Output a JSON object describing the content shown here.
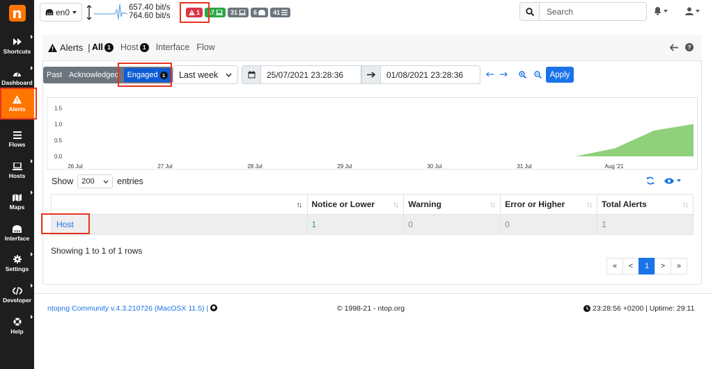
{
  "sidebar": {
    "logo": "n",
    "items": [
      {
        "label": "Shortcuts",
        "icon": "fast-forward-icon"
      },
      {
        "label": "Dashboard",
        "icon": "gauge-icon"
      },
      {
        "label": "Alerts",
        "icon": "warning-icon",
        "active": true
      },
      {
        "label": "Flows",
        "icon": "stream-icon"
      },
      {
        "label": "Hosts",
        "icon": "laptop-icon"
      },
      {
        "label": "Maps",
        "icon": "map-icon"
      },
      {
        "label": "Interface",
        "icon": "ethernet-icon"
      },
      {
        "label": "Settings",
        "icon": "gear-icon"
      },
      {
        "label": "Developer",
        "icon": "code-icon"
      },
      {
        "label": "Help",
        "icon": "life-ring-icon"
      }
    ]
  },
  "topbar": {
    "interface": "en0",
    "throughput_up": "657.40 bit/s",
    "throughput_down": "764.60 bit/s",
    "badges": {
      "alerts": "1",
      "local_hosts": "17",
      "hosts": "31",
      "devices": "6",
      "flows": "41"
    },
    "search_button": "search-icon",
    "search_placeholder": "Search"
  },
  "alerts_header": {
    "title": "Alerts",
    "separator": "|",
    "tabs": [
      {
        "label": "All",
        "count": "1"
      },
      {
        "label": "Host",
        "count": "1"
      },
      {
        "label": "Interface"
      },
      {
        "label": "Flow"
      }
    ]
  },
  "filter": {
    "past": "Past",
    "acknowledged": "Acknowledged",
    "engaged": "Engaged",
    "engaged_count": "1",
    "range": "Last week",
    "date_from": "25/07/2021 23:28:36",
    "date_to": "01/08/2021 23:28:36",
    "apply": "Apply"
  },
  "chart_data": {
    "type": "area",
    "x_ticks": [
      "26 Jul",
      "27 Jul",
      "28 Jul",
      "29 Jul",
      "30 Jul",
      "31 Jul",
      "Aug '21"
    ],
    "y_ticks": [
      "1.5",
      "1.0",
      "0.5",
      "0.0"
    ],
    "ylim": [
      0,
      1.7
    ],
    "series": [
      {
        "color": "#8fd07a",
        "values": [
          0,
          0,
          0,
          0,
          0,
          0,
          0,
          0,
          0,
          0,
          0,
          0,
          0,
          0,
          0.25,
          0.8,
          1.0
        ]
      }
    ],
    "grid": false,
    "title": "",
    "xlabel": "",
    "ylabel": ""
  },
  "table_controls": {
    "show": "Show",
    "entries_value": "200",
    "entries": "entries"
  },
  "table": {
    "columns": [
      "",
      "Notice or Lower",
      "Warning",
      "Error or Higher",
      "Total Alerts"
    ],
    "rows": [
      [
        "Host",
        "1",
        "0",
        "0",
        "1"
      ]
    ],
    "info": "Showing 1 to 1 of 1 rows",
    "pager": [
      "«",
      "<",
      "1",
      ">",
      "»"
    ]
  },
  "footer": {
    "version": "ntopng Community v.4.3.210726 (MacOSX 11.5) |",
    "copyright": "© 1998-21 - ntop.org",
    "status": "23:28:56 +0200 | Uptime: 29:11"
  }
}
